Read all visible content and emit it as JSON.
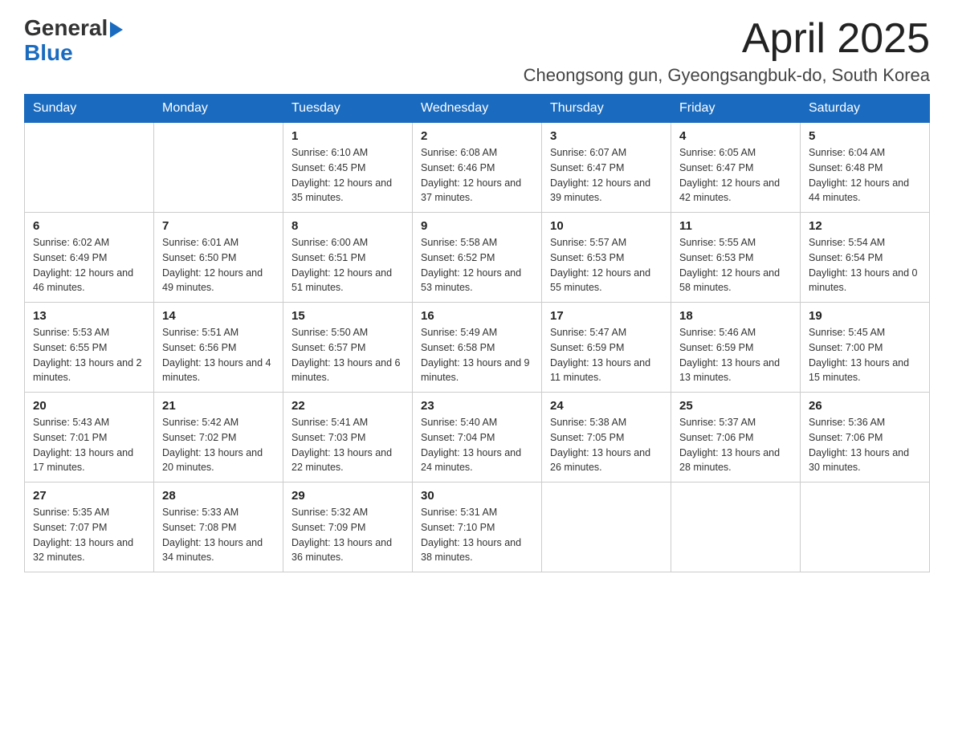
{
  "header": {
    "logo_general": "General",
    "logo_blue": "Blue",
    "month_year": "April 2025",
    "location": "Cheongsong gun, Gyeongsangbuk-do, South Korea"
  },
  "days_of_week": [
    "Sunday",
    "Monday",
    "Tuesday",
    "Wednesday",
    "Thursday",
    "Friday",
    "Saturday"
  ],
  "weeks": [
    [
      {
        "day": "",
        "sunrise": "",
        "sunset": "",
        "daylight": ""
      },
      {
        "day": "",
        "sunrise": "",
        "sunset": "",
        "daylight": ""
      },
      {
        "day": "1",
        "sunrise": "Sunrise: 6:10 AM",
        "sunset": "Sunset: 6:45 PM",
        "daylight": "Daylight: 12 hours and 35 minutes."
      },
      {
        "day": "2",
        "sunrise": "Sunrise: 6:08 AM",
        "sunset": "Sunset: 6:46 PM",
        "daylight": "Daylight: 12 hours and 37 minutes."
      },
      {
        "day": "3",
        "sunrise": "Sunrise: 6:07 AM",
        "sunset": "Sunset: 6:47 PM",
        "daylight": "Daylight: 12 hours and 39 minutes."
      },
      {
        "day": "4",
        "sunrise": "Sunrise: 6:05 AM",
        "sunset": "Sunset: 6:47 PM",
        "daylight": "Daylight: 12 hours and 42 minutes."
      },
      {
        "day": "5",
        "sunrise": "Sunrise: 6:04 AM",
        "sunset": "Sunset: 6:48 PM",
        "daylight": "Daylight: 12 hours and 44 minutes."
      }
    ],
    [
      {
        "day": "6",
        "sunrise": "Sunrise: 6:02 AM",
        "sunset": "Sunset: 6:49 PM",
        "daylight": "Daylight: 12 hours and 46 minutes."
      },
      {
        "day": "7",
        "sunrise": "Sunrise: 6:01 AM",
        "sunset": "Sunset: 6:50 PM",
        "daylight": "Daylight: 12 hours and 49 minutes."
      },
      {
        "day": "8",
        "sunrise": "Sunrise: 6:00 AM",
        "sunset": "Sunset: 6:51 PM",
        "daylight": "Daylight: 12 hours and 51 minutes."
      },
      {
        "day": "9",
        "sunrise": "Sunrise: 5:58 AM",
        "sunset": "Sunset: 6:52 PM",
        "daylight": "Daylight: 12 hours and 53 minutes."
      },
      {
        "day": "10",
        "sunrise": "Sunrise: 5:57 AM",
        "sunset": "Sunset: 6:53 PM",
        "daylight": "Daylight: 12 hours and 55 minutes."
      },
      {
        "day": "11",
        "sunrise": "Sunrise: 5:55 AM",
        "sunset": "Sunset: 6:53 PM",
        "daylight": "Daylight: 12 hours and 58 minutes."
      },
      {
        "day": "12",
        "sunrise": "Sunrise: 5:54 AM",
        "sunset": "Sunset: 6:54 PM",
        "daylight": "Daylight: 13 hours and 0 minutes."
      }
    ],
    [
      {
        "day": "13",
        "sunrise": "Sunrise: 5:53 AM",
        "sunset": "Sunset: 6:55 PM",
        "daylight": "Daylight: 13 hours and 2 minutes."
      },
      {
        "day": "14",
        "sunrise": "Sunrise: 5:51 AM",
        "sunset": "Sunset: 6:56 PM",
        "daylight": "Daylight: 13 hours and 4 minutes."
      },
      {
        "day": "15",
        "sunrise": "Sunrise: 5:50 AM",
        "sunset": "Sunset: 6:57 PM",
        "daylight": "Daylight: 13 hours and 6 minutes."
      },
      {
        "day": "16",
        "sunrise": "Sunrise: 5:49 AM",
        "sunset": "Sunset: 6:58 PM",
        "daylight": "Daylight: 13 hours and 9 minutes."
      },
      {
        "day": "17",
        "sunrise": "Sunrise: 5:47 AM",
        "sunset": "Sunset: 6:59 PM",
        "daylight": "Daylight: 13 hours and 11 minutes."
      },
      {
        "day": "18",
        "sunrise": "Sunrise: 5:46 AM",
        "sunset": "Sunset: 6:59 PM",
        "daylight": "Daylight: 13 hours and 13 minutes."
      },
      {
        "day": "19",
        "sunrise": "Sunrise: 5:45 AM",
        "sunset": "Sunset: 7:00 PM",
        "daylight": "Daylight: 13 hours and 15 minutes."
      }
    ],
    [
      {
        "day": "20",
        "sunrise": "Sunrise: 5:43 AM",
        "sunset": "Sunset: 7:01 PM",
        "daylight": "Daylight: 13 hours and 17 minutes."
      },
      {
        "day": "21",
        "sunrise": "Sunrise: 5:42 AM",
        "sunset": "Sunset: 7:02 PM",
        "daylight": "Daylight: 13 hours and 20 minutes."
      },
      {
        "day": "22",
        "sunrise": "Sunrise: 5:41 AM",
        "sunset": "Sunset: 7:03 PM",
        "daylight": "Daylight: 13 hours and 22 minutes."
      },
      {
        "day": "23",
        "sunrise": "Sunrise: 5:40 AM",
        "sunset": "Sunset: 7:04 PM",
        "daylight": "Daylight: 13 hours and 24 minutes."
      },
      {
        "day": "24",
        "sunrise": "Sunrise: 5:38 AM",
        "sunset": "Sunset: 7:05 PM",
        "daylight": "Daylight: 13 hours and 26 minutes."
      },
      {
        "day": "25",
        "sunrise": "Sunrise: 5:37 AM",
        "sunset": "Sunset: 7:06 PM",
        "daylight": "Daylight: 13 hours and 28 minutes."
      },
      {
        "day": "26",
        "sunrise": "Sunrise: 5:36 AM",
        "sunset": "Sunset: 7:06 PM",
        "daylight": "Daylight: 13 hours and 30 minutes."
      }
    ],
    [
      {
        "day": "27",
        "sunrise": "Sunrise: 5:35 AM",
        "sunset": "Sunset: 7:07 PM",
        "daylight": "Daylight: 13 hours and 32 minutes."
      },
      {
        "day": "28",
        "sunrise": "Sunrise: 5:33 AM",
        "sunset": "Sunset: 7:08 PM",
        "daylight": "Daylight: 13 hours and 34 minutes."
      },
      {
        "day": "29",
        "sunrise": "Sunrise: 5:32 AM",
        "sunset": "Sunset: 7:09 PM",
        "daylight": "Daylight: 13 hours and 36 minutes."
      },
      {
        "day": "30",
        "sunrise": "Sunrise: 5:31 AM",
        "sunset": "Sunset: 7:10 PM",
        "daylight": "Daylight: 13 hours and 38 minutes."
      },
      {
        "day": "",
        "sunrise": "",
        "sunset": "",
        "daylight": ""
      },
      {
        "day": "",
        "sunrise": "",
        "sunset": "",
        "daylight": ""
      },
      {
        "day": "",
        "sunrise": "",
        "sunset": "",
        "daylight": ""
      }
    ]
  ]
}
